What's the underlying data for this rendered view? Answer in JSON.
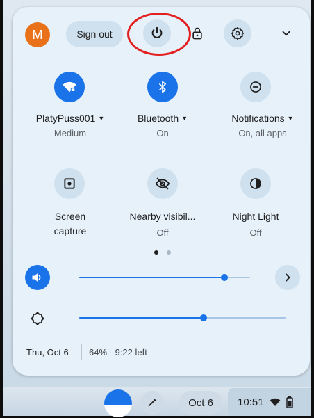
{
  "top_row": {
    "avatar_letter": "M",
    "sign_out_label": "Sign out",
    "icons": [
      "power-icon",
      "lock-icon",
      "gear-icon",
      "chevron-down-icon"
    ]
  },
  "tiles": [
    {
      "label": "PlatyPuss001",
      "sub": "Medium",
      "icon": "wifi-locked-icon",
      "state": "on",
      "has_caret": true
    },
    {
      "label": "Bluetooth",
      "sub": "On",
      "icon": "bluetooth-icon",
      "state": "on",
      "has_caret": true
    },
    {
      "label": "Notifications",
      "sub": "On, all apps",
      "icon": "notifications-icon",
      "state": "off",
      "has_caret": true
    },
    {
      "label": "Screen",
      "label2": "capture",
      "sub": "",
      "icon": "screen-capture-icon",
      "state": "off"
    },
    {
      "label": "Nearby visibil...",
      "sub": "Off",
      "icon": "visibility-off-icon",
      "state": "off"
    },
    {
      "label": "Night Light",
      "sub": "Off",
      "icon": "night-light-icon",
      "state": "off"
    }
  ],
  "pager": {
    "pages": 2,
    "current": 1
  },
  "sliders": {
    "volume_level": 0.85,
    "brightness_level": 0.6
  },
  "footer": {
    "date": "Thu, Oct 6",
    "battery": "64% - 9:22 left"
  },
  "shelf": {
    "date_pill": "Oct 6",
    "time": "10:51"
  },
  "colors": {
    "accent": "#1a73e8",
    "panel_bg": "#e6f1fa",
    "avatar": "#e8711a",
    "highlight_ring": "#e32020"
  }
}
